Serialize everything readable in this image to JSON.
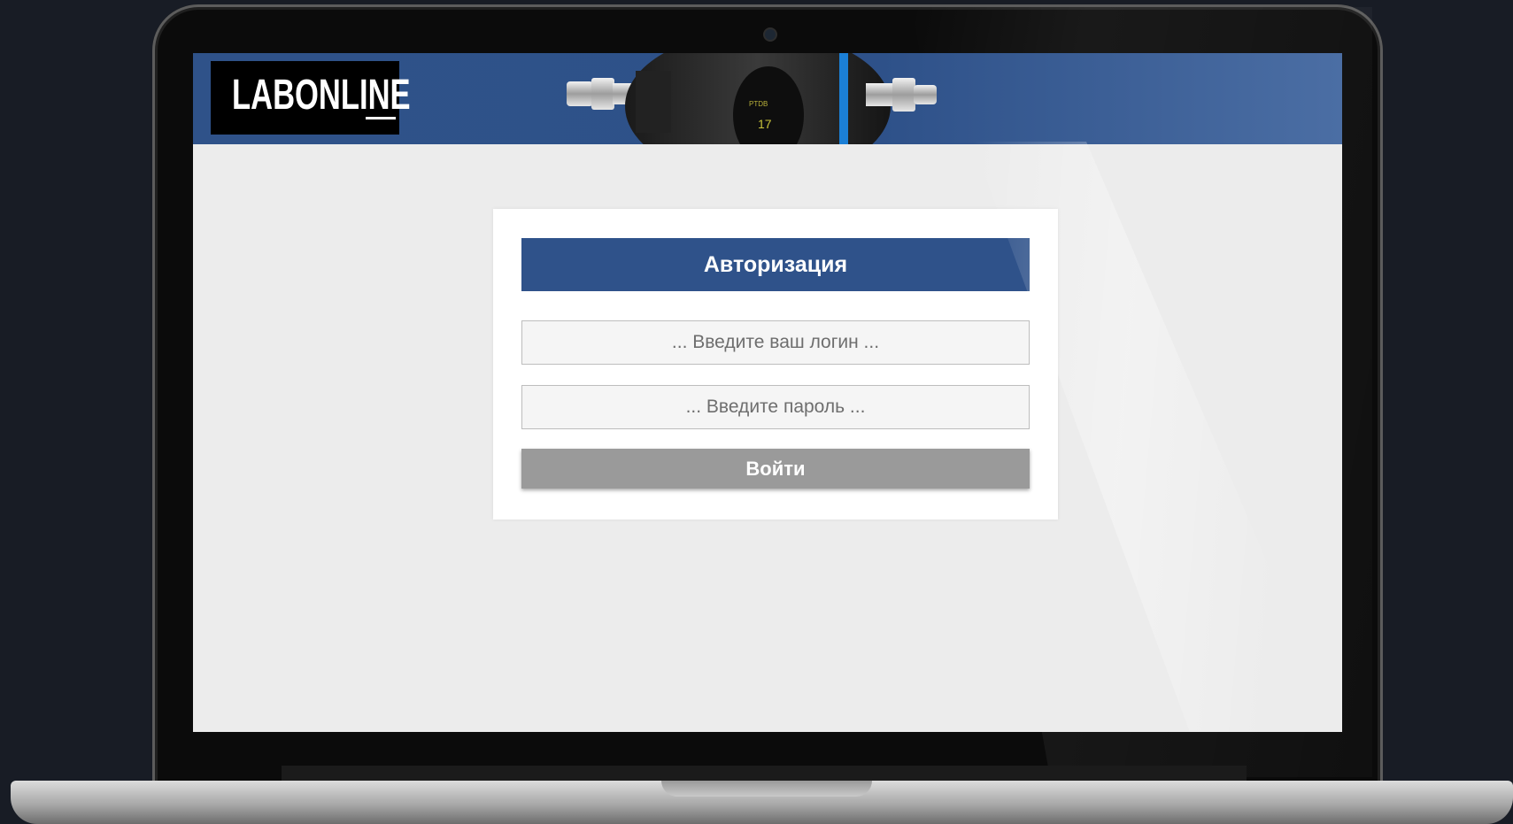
{
  "brand": {
    "logo_text": "LABONLINE"
  },
  "auth": {
    "title": "Авторизация",
    "login_placeholder": "... Введите ваш логин ...",
    "password_placeholder": "... Введите пароль ...",
    "submit_label": "Войти"
  },
  "colors": {
    "primary": "#2f528a",
    "button_gray": "#9a9a9a",
    "page_bg": "#ececec",
    "outer_bg": "#181c25"
  },
  "icons": {
    "header_image": "gas-pressure-gauge-device"
  }
}
